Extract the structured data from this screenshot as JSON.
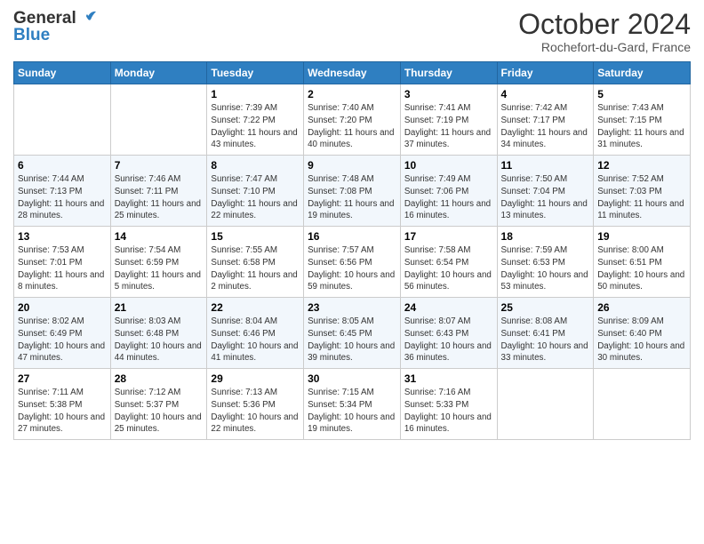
{
  "header": {
    "logo_line1": "General",
    "logo_line2": "Blue",
    "month": "October 2024",
    "location": "Rochefort-du-Gard, France"
  },
  "days_header": [
    "Sunday",
    "Monday",
    "Tuesday",
    "Wednesday",
    "Thursday",
    "Friday",
    "Saturday"
  ],
  "weeks": [
    [
      {
        "day": "",
        "content": ""
      },
      {
        "day": "",
        "content": ""
      },
      {
        "day": "1",
        "content": "Sunrise: 7:39 AM\nSunset: 7:22 PM\nDaylight: 11 hours and 43 minutes."
      },
      {
        "day": "2",
        "content": "Sunrise: 7:40 AM\nSunset: 7:20 PM\nDaylight: 11 hours and 40 minutes."
      },
      {
        "day": "3",
        "content": "Sunrise: 7:41 AM\nSunset: 7:19 PM\nDaylight: 11 hours and 37 minutes."
      },
      {
        "day": "4",
        "content": "Sunrise: 7:42 AM\nSunset: 7:17 PM\nDaylight: 11 hours and 34 minutes."
      },
      {
        "day": "5",
        "content": "Sunrise: 7:43 AM\nSunset: 7:15 PM\nDaylight: 11 hours and 31 minutes."
      }
    ],
    [
      {
        "day": "6",
        "content": "Sunrise: 7:44 AM\nSunset: 7:13 PM\nDaylight: 11 hours and 28 minutes."
      },
      {
        "day": "7",
        "content": "Sunrise: 7:46 AM\nSunset: 7:11 PM\nDaylight: 11 hours and 25 minutes."
      },
      {
        "day": "8",
        "content": "Sunrise: 7:47 AM\nSunset: 7:10 PM\nDaylight: 11 hours and 22 minutes."
      },
      {
        "day": "9",
        "content": "Sunrise: 7:48 AM\nSunset: 7:08 PM\nDaylight: 11 hours and 19 minutes."
      },
      {
        "day": "10",
        "content": "Sunrise: 7:49 AM\nSunset: 7:06 PM\nDaylight: 11 hours and 16 minutes."
      },
      {
        "day": "11",
        "content": "Sunrise: 7:50 AM\nSunset: 7:04 PM\nDaylight: 11 hours and 13 minutes."
      },
      {
        "day": "12",
        "content": "Sunrise: 7:52 AM\nSunset: 7:03 PM\nDaylight: 11 hours and 11 minutes."
      }
    ],
    [
      {
        "day": "13",
        "content": "Sunrise: 7:53 AM\nSunset: 7:01 PM\nDaylight: 11 hours and 8 minutes."
      },
      {
        "day": "14",
        "content": "Sunrise: 7:54 AM\nSunset: 6:59 PM\nDaylight: 11 hours and 5 minutes."
      },
      {
        "day": "15",
        "content": "Sunrise: 7:55 AM\nSunset: 6:58 PM\nDaylight: 11 hours and 2 minutes."
      },
      {
        "day": "16",
        "content": "Sunrise: 7:57 AM\nSunset: 6:56 PM\nDaylight: 10 hours and 59 minutes."
      },
      {
        "day": "17",
        "content": "Sunrise: 7:58 AM\nSunset: 6:54 PM\nDaylight: 10 hours and 56 minutes."
      },
      {
        "day": "18",
        "content": "Sunrise: 7:59 AM\nSunset: 6:53 PM\nDaylight: 10 hours and 53 minutes."
      },
      {
        "day": "19",
        "content": "Sunrise: 8:00 AM\nSunset: 6:51 PM\nDaylight: 10 hours and 50 minutes."
      }
    ],
    [
      {
        "day": "20",
        "content": "Sunrise: 8:02 AM\nSunset: 6:49 PM\nDaylight: 10 hours and 47 minutes."
      },
      {
        "day": "21",
        "content": "Sunrise: 8:03 AM\nSunset: 6:48 PM\nDaylight: 10 hours and 44 minutes."
      },
      {
        "day": "22",
        "content": "Sunrise: 8:04 AM\nSunset: 6:46 PM\nDaylight: 10 hours and 41 minutes."
      },
      {
        "day": "23",
        "content": "Sunrise: 8:05 AM\nSunset: 6:45 PM\nDaylight: 10 hours and 39 minutes."
      },
      {
        "day": "24",
        "content": "Sunrise: 8:07 AM\nSunset: 6:43 PM\nDaylight: 10 hours and 36 minutes."
      },
      {
        "day": "25",
        "content": "Sunrise: 8:08 AM\nSunset: 6:41 PM\nDaylight: 10 hours and 33 minutes."
      },
      {
        "day": "26",
        "content": "Sunrise: 8:09 AM\nSunset: 6:40 PM\nDaylight: 10 hours and 30 minutes."
      }
    ],
    [
      {
        "day": "27",
        "content": "Sunrise: 7:11 AM\nSunset: 5:38 PM\nDaylight: 10 hours and 27 minutes."
      },
      {
        "day": "28",
        "content": "Sunrise: 7:12 AM\nSunset: 5:37 PM\nDaylight: 10 hours and 25 minutes."
      },
      {
        "day": "29",
        "content": "Sunrise: 7:13 AM\nSunset: 5:36 PM\nDaylight: 10 hours and 22 minutes."
      },
      {
        "day": "30",
        "content": "Sunrise: 7:15 AM\nSunset: 5:34 PM\nDaylight: 10 hours and 19 minutes."
      },
      {
        "day": "31",
        "content": "Sunrise: 7:16 AM\nSunset: 5:33 PM\nDaylight: 10 hours and 16 minutes."
      },
      {
        "day": "",
        "content": ""
      },
      {
        "day": "",
        "content": ""
      }
    ]
  ]
}
